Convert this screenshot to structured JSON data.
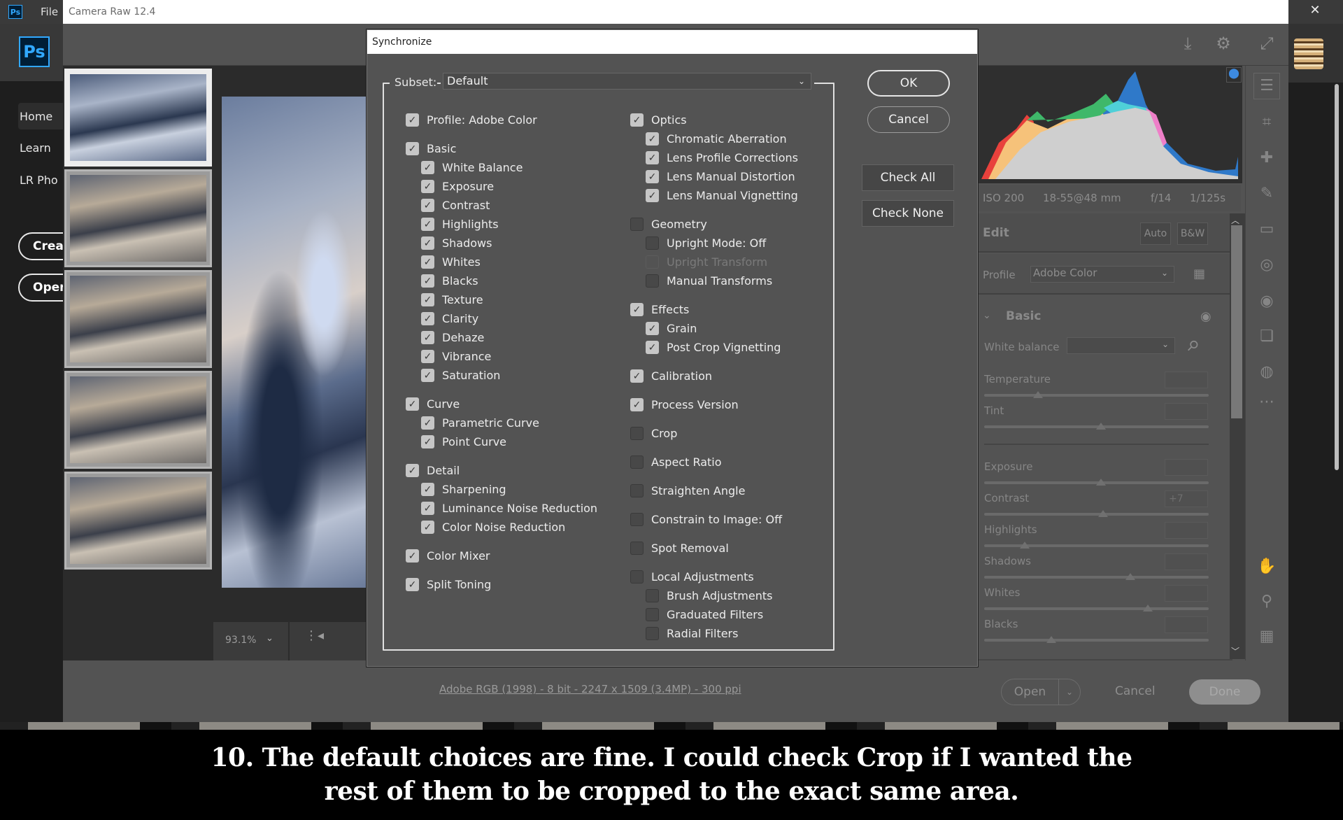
{
  "photoshop": {
    "logo_small": "Ps",
    "menu_file": "File",
    "logo_big": "Ps",
    "nav": [
      "Home",
      "Learn",
      "LR Pho"
    ],
    "create_button": "Creat",
    "open_button": "Open",
    "close_glyph": "✕"
  },
  "camera_raw": {
    "title": "Camera Raw 12.4",
    "top_icons": [
      "save-icon",
      "settings-gear-icon",
      "fullscreen-icon"
    ],
    "zoom_level": "93.1%",
    "file_info": "Adobe RGB (1998) - 8 bit - 2247 x 1509 (3.4MP) - 300 ppi",
    "buttons": {
      "open": "Open",
      "cancel": "Cancel",
      "done": "Done"
    },
    "filmstrip": {
      "count": 5,
      "selected_index": 0
    },
    "exif": {
      "iso": "ISO 200",
      "lens": "18-55@48 mm",
      "aperture": "f/14",
      "shutter": "1/125s"
    },
    "edit": {
      "title": "Edit",
      "auto": "Auto",
      "bw": "B&W",
      "profile_label": "Profile",
      "profile_value": "Adobe Color",
      "basic_title": "Basic",
      "white_balance_label": "White balance",
      "white_balance_value": "",
      "sliders": [
        {
          "label": "Temperature",
          "value": "",
          "position": 0.24
        },
        {
          "label": "Tint",
          "value": "",
          "position": 0.52
        },
        {
          "label": "Exposure",
          "value": "",
          "position": 0.52
        },
        {
          "label": "Contrast",
          "value": "+7",
          "position": 0.53
        },
        {
          "label": "Highlights",
          "value": "",
          "position": 0.18
        },
        {
          "label": "Shadows",
          "value": "",
          "position": 0.65
        },
        {
          "label": "Whites",
          "value": "",
          "position": 0.73
        },
        {
          "label": "Blacks",
          "value": "",
          "position": 0.3
        }
      ]
    },
    "tools": [
      "edit-sliders-icon",
      "crop-icon",
      "healing-icon",
      "brush-icon",
      "graduated-filter-icon",
      "radial-filter-icon",
      "red-eye-icon",
      "snapshots-icon",
      "presets-icon",
      "more-icon",
      "hand-icon",
      "color-sampler-icon",
      "grid-icon"
    ],
    "histogram_colors": {
      "red": "#e8413c",
      "orange": "#f6c27a",
      "green": "#3fb86a",
      "cyan": "#4fd0d8",
      "blue": "#2f79c9",
      "magenta": "#ee7fc8",
      "gray": "#cfcfcf"
    }
  },
  "dialog": {
    "title": "Synchronize",
    "subset_label": "Subset:",
    "subset_value": "Default",
    "ok": "OK",
    "cancel": "Cancel",
    "check_all": "Check All",
    "check_none": "Check None",
    "left_column": [
      {
        "label": "Profile: Adobe Color",
        "checked": true,
        "level": 0
      },
      {
        "label": "Basic",
        "checked": true,
        "level": 0
      },
      {
        "label": "White Balance",
        "checked": true,
        "level": 1
      },
      {
        "label": "Exposure",
        "checked": true,
        "level": 1
      },
      {
        "label": "Contrast",
        "checked": true,
        "level": 1
      },
      {
        "label": "Highlights",
        "checked": true,
        "level": 1
      },
      {
        "label": "Shadows",
        "checked": true,
        "level": 1
      },
      {
        "label": "Whites",
        "checked": true,
        "level": 1
      },
      {
        "label": "Blacks",
        "checked": true,
        "level": 1
      },
      {
        "label": "Texture",
        "checked": true,
        "level": 1
      },
      {
        "label": "Clarity",
        "checked": true,
        "level": 1
      },
      {
        "label": "Dehaze",
        "checked": true,
        "level": 1
      },
      {
        "label": "Vibrance",
        "checked": true,
        "level": 1
      },
      {
        "label": "Saturation",
        "checked": true,
        "level": 1
      },
      {
        "label": "Curve",
        "checked": true,
        "level": 0
      },
      {
        "label": "Parametric Curve",
        "checked": true,
        "level": 1
      },
      {
        "label": "Point Curve",
        "checked": true,
        "level": 1
      },
      {
        "label": "Detail",
        "checked": true,
        "level": 0
      },
      {
        "label": "Sharpening",
        "checked": true,
        "level": 1
      },
      {
        "label": "Luminance Noise Reduction",
        "checked": true,
        "level": 1
      },
      {
        "label": "Color Noise Reduction",
        "checked": true,
        "level": 1
      },
      {
        "label": "Color Mixer",
        "checked": true,
        "level": 0
      },
      {
        "label": "Split Toning",
        "checked": true,
        "level": 0
      }
    ],
    "right_column": [
      {
        "label": "Optics",
        "checked": true,
        "level": 0
      },
      {
        "label": "Chromatic Aberration",
        "checked": true,
        "level": 1
      },
      {
        "label": "Lens Profile Corrections",
        "checked": true,
        "level": 1
      },
      {
        "label": "Lens Manual Distortion",
        "checked": true,
        "level": 1
      },
      {
        "label": "Lens Manual Vignetting",
        "checked": true,
        "level": 1
      },
      {
        "label": "Geometry",
        "checked": false,
        "level": 0
      },
      {
        "label": "Upright Mode: Off",
        "checked": false,
        "level": 1
      },
      {
        "label": "Upright Transform",
        "checked": false,
        "level": 1,
        "disabled": true
      },
      {
        "label": "Manual Transforms",
        "checked": false,
        "level": 1
      },
      {
        "label": "Effects",
        "checked": true,
        "level": 0
      },
      {
        "label": "Grain",
        "checked": true,
        "level": 1
      },
      {
        "label": "Post Crop Vignetting",
        "checked": true,
        "level": 1
      },
      {
        "label": "Calibration",
        "checked": true,
        "level": 0
      },
      {
        "label": "Process Version",
        "checked": true,
        "level": 0
      },
      {
        "label": "Crop",
        "checked": false,
        "level": 0
      },
      {
        "label": "Aspect Ratio",
        "checked": false,
        "level": 0
      },
      {
        "label": "Straighten Angle",
        "checked": false,
        "level": 0
      },
      {
        "label": "Constrain to Image: Off",
        "checked": false,
        "level": 0
      },
      {
        "label": "Spot Removal",
        "checked": false,
        "level": 0
      },
      {
        "label": "Local Adjustments",
        "checked": false,
        "level": 0
      },
      {
        "label": "Brush Adjustments",
        "checked": false,
        "level": 1
      },
      {
        "label": "Graduated Filters",
        "checked": false,
        "level": 1
      },
      {
        "label": "Radial Filters",
        "checked": false,
        "level": 1
      }
    ]
  },
  "caption": {
    "line1": "10. The default choices are fine. I could check Crop if I wanted the",
    "line2": "rest of them to be cropped to the exact same area."
  }
}
